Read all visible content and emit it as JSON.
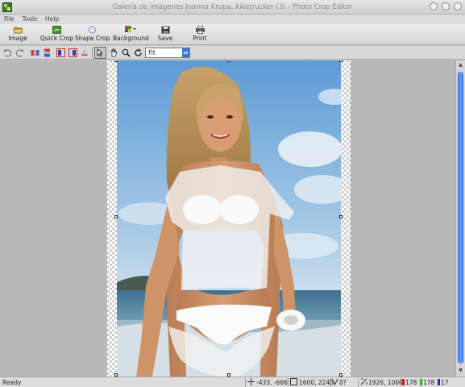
{
  "window": {
    "title": "Galería de imágenes Joanna Krupa, kiketrucker (3) - Photo Crop Editor",
    "icon": "photo-crop-app-icon"
  },
  "menu": [
    "File",
    "Tools",
    "Help"
  ],
  "toolbar": {
    "buttons": [
      {
        "label": "Image",
        "icon": "open-folder-icon"
      },
      {
        "label": "Quick Crop",
        "icon": "quick-crop-icon"
      },
      {
        "label": "Shape Crop",
        "icon": "shape-crop-icon"
      },
      {
        "label": "Background",
        "icon": "background-palette-icon"
      },
      {
        "label": "Save",
        "icon": "floppy-disk-icon"
      },
      {
        "label": "Print",
        "icon": "printer-icon"
      }
    ]
  },
  "subtoolbar": {
    "zoom_value": "Fit"
  },
  "status": {
    "ready": "Ready",
    "cursor_pos": "-433, -666",
    "image_size": "1600, 2240",
    "angle": "0?",
    "selection_size": "1926, 1000",
    "red": "178",
    "green": "178",
    "blue": "17"
  },
  "colors": {
    "red_chip": "#e01010",
    "green_chip": "#10c010",
    "blue_chip": "#1030e0",
    "scroll_thumb": "#3c78d8",
    "accent": "#2f6fe0"
  }
}
